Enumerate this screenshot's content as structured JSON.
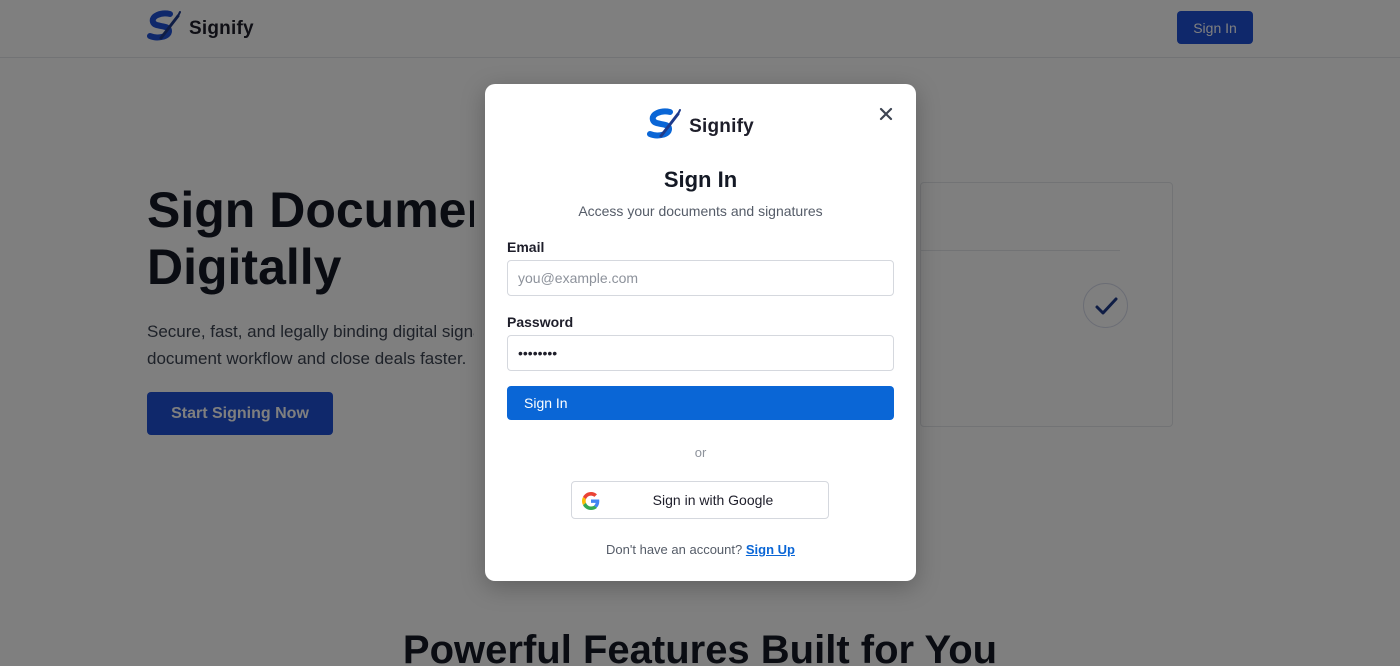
{
  "page": {
    "brand": {
      "name": "Signify",
      "logo_icon": "signify-logo-icon"
    },
    "nav": {
      "signin_label": "Sign In"
    },
    "hero": {
      "title": "Sign Documents\nDigitally",
      "subtitle": "Secure, fast, and legally binding digital signatures. Streamline your document workflow and close deals faster.",
      "cta_label": "Start Signing Now",
      "card_icon": "checkmark-icon"
    },
    "features_title": "Powerful Features Built for You"
  },
  "modal": {
    "brand_name": "Signify",
    "close_icon": "close-icon",
    "title": "Sign In",
    "subtitle": "Access your documents and signatures",
    "email": {
      "label": "Email",
      "placeholder": "you@example.com",
      "value": ""
    },
    "password": {
      "label": "Password",
      "value": "••••••••"
    },
    "submit_label": "Sign In",
    "divider_text": "or",
    "google": {
      "label": "Sign in with Google",
      "icon": "google-icon"
    },
    "signup": {
      "prompt": "Don't have an account?",
      "link_label": "Sign Up"
    }
  },
  "colors": {
    "primary": "#1e50d6",
    "modal_primary": "#0a66d6",
    "overlay": "rgba(0,0,0,0.5)",
    "text_dark": "#141925"
  }
}
